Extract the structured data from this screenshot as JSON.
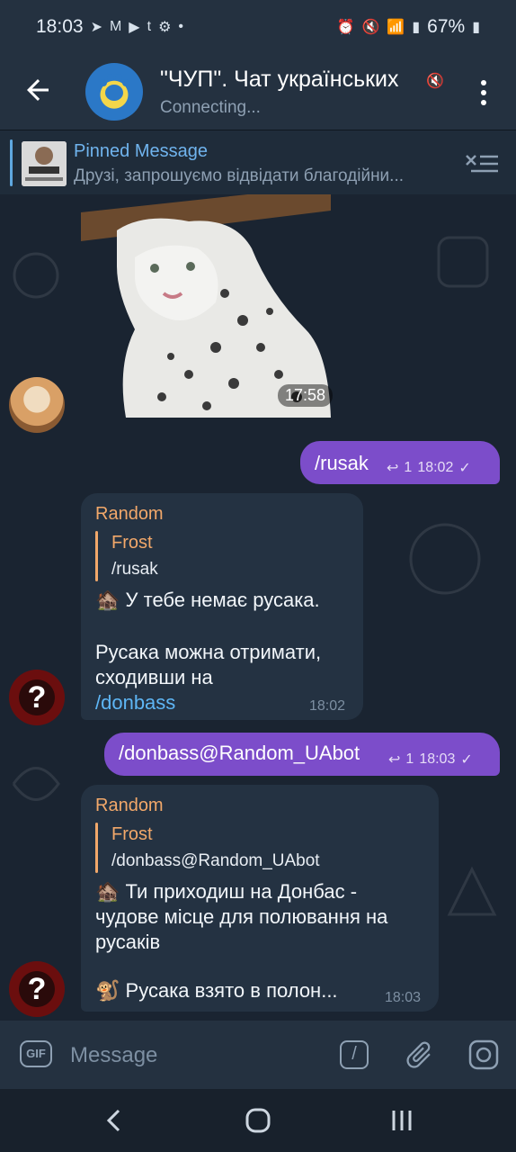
{
  "status_bar": {
    "time": "18:03",
    "battery": "67%",
    "left_icons": [
      "telegram-icon",
      "gmail-icon",
      "youtube-icon",
      "tumblr-icon",
      "settings-icon",
      "dot-icon"
    ],
    "right_icons": [
      "alarm-icon",
      "mute-icon",
      "wifi-icon",
      "signal-icon",
      "signal-icon",
      "battery-icon"
    ]
  },
  "header": {
    "title": "\"ЧУП\". Чат українських",
    "status": "Connecting..."
  },
  "pinned": {
    "title": "Pinned Message",
    "text": "Друзі, запрошуємо відвідати благодійни..."
  },
  "messages": {
    "sticker": {
      "time": "17:58"
    },
    "out1": {
      "text": "/rusak",
      "replies": "1",
      "time": "18:02"
    },
    "in1": {
      "sender": "Random",
      "quote_name": "Frost",
      "quote_text": "/rusak",
      "emoji": "🏚️",
      "line1": "У тебе немає русака.",
      "line2": "Русака можна отримати,",
      "line3": "сходивши на",
      "link": "/donbass",
      "time": "18:02"
    },
    "out2": {
      "text": "/donbass@Random_UAbot",
      "replies": "1",
      "time": "18:03"
    },
    "in2": {
      "sender": "Random",
      "quote_name": "Frost",
      "quote_text": "/donbass@Random_UAbot",
      "emoji1": "🏚️",
      "line1": "Ти приходиш на Донбас -",
      "line2": "чудове місце для полювання на",
      "line3": "русаків",
      "emoji2": "🐒",
      "line4": "Русака взято в полон...",
      "time": "18:03"
    },
    "avatar_glyph": "?"
  },
  "input": {
    "placeholder": "Message",
    "gif_label": "GIF",
    "command_label": "/"
  }
}
